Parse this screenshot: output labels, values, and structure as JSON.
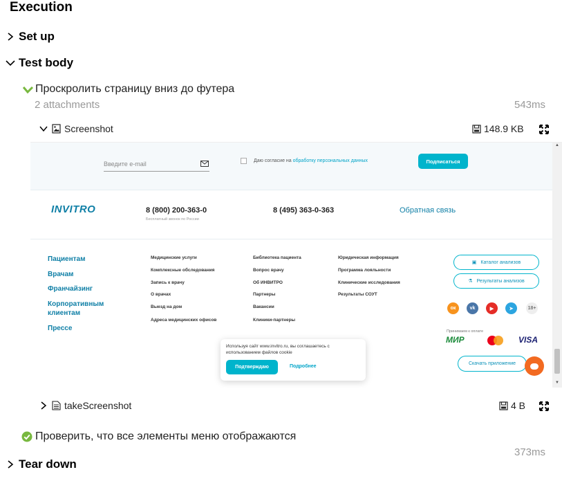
{
  "execution": {
    "title": "Execution",
    "sections": {
      "setup": "Set up",
      "test_body": "Test body",
      "tear_down": "Tear down"
    },
    "steps": [
      {
        "title": "Проскролить страницу вниз до футера",
        "attachments": "2 attachments",
        "duration": "543ms"
      },
      {
        "title": "Проверить, что все элементы меню отображаются",
        "duration": "373ms"
      }
    ],
    "attachments": [
      {
        "name": "Screenshot",
        "size": "148.9 KB"
      },
      {
        "name": "takeScreenshot",
        "size": "4 B"
      }
    ],
    "colors": {
      "pass_green": "#78b83f",
      "meta_gray": "#999999"
    }
  },
  "screenshot": {
    "email_placeholder": "Введите e-mail",
    "consent_text": "Даю согласие на",
    "consent_link": "обработку персональных данных",
    "subscribe_button": "Подписаться",
    "logo": "INVITRO",
    "phone1": "8 (800) 200-363-0",
    "phone1_note": "Бесплатный звонок по России",
    "phone2": "8 (495) 363-0-363",
    "feedback_link": "Обратная связь",
    "nav_main": [
      "Пациентам",
      "Врачам",
      "Франчайзинг",
      "Корпоративным клиентам",
      "Прессе"
    ],
    "nav_col1": [
      "Медицинские услуги",
      "Комплексные обследования",
      "Запись к врачу",
      "О врачах",
      "Выезд на дом",
      "Адреса медицинских офисов"
    ],
    "nav_col2": [
      "Библиотека пациента",
      "Вопрос врачу",
      "Об ИНВИТРО",
      "Партнеры",
      "Вакансии",
      "Клиники-партнеры"
    ],
    "nav_col3": [
      "Юридическая информация",
      "Программа лояльности",
      "Клинические исследования",
      "Результаты СОУТ"
    ],
    "catalog_button": "Каталог анализов",
    "results_button": "Результаты анализов",
    "age_badge": "18+",
    "payments_label": "Принимаем к оплате",
    "payment_mir": "МИР",
    "payment_visa": "VISA",
    "download_app": "Скачать приложение",
    "cookie_text": "Используя сайт www.invitro.ru, вы соглашаетесь с использованием файлов cookie",
    "cookie_confirm": "Подтверждаю",
    "cookie_more": "Подробнее",
    "colors": {
      "teal": "#00b4cc",
      "brand_blue": "#0f7fa6",
      "chat_orange": "#f26a21"
    }
  }
}
